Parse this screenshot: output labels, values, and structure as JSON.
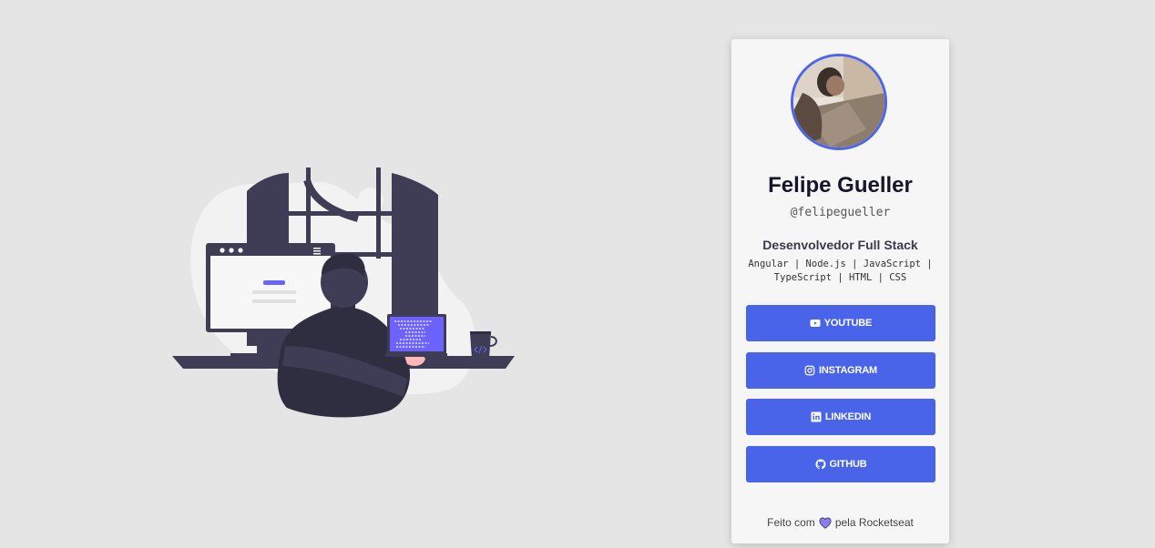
{
  "profile": {
    "name": "Felipe Gueller",
    "username": "@felipegueller",
    "role": "Desenvolvedor Full Stack",
    "techs": "Angular | Node.js | JavaScript | TypeScript | HTML | CSS"
  },
  "links": [
    {
      "label": "YOUTUBE",
      "icon": "youtube-icon"
    },
    {
      "label": "INSTAGRAM",
      "icon": "instagram-icon"
    },
    {
      "label": "LINKEDIN",
      "icon": "linkedin-icon"
    },
    {
      "label": "GITHUB",
      "icon": "github-icon"
    }
  ],
  "footer": {
    "before": "Feito com",
    "after": "pela Rocketseat",
    "icon": "heart-icon"
  },
  "colors": {
    "accent": "#4964e8",
    "background": "#e5e5e5",
    "card": "#f6f6f6",
    "illustration_dark": "#3f3d56",
    "illustration_accent": "#6c63ff"
  }
}
